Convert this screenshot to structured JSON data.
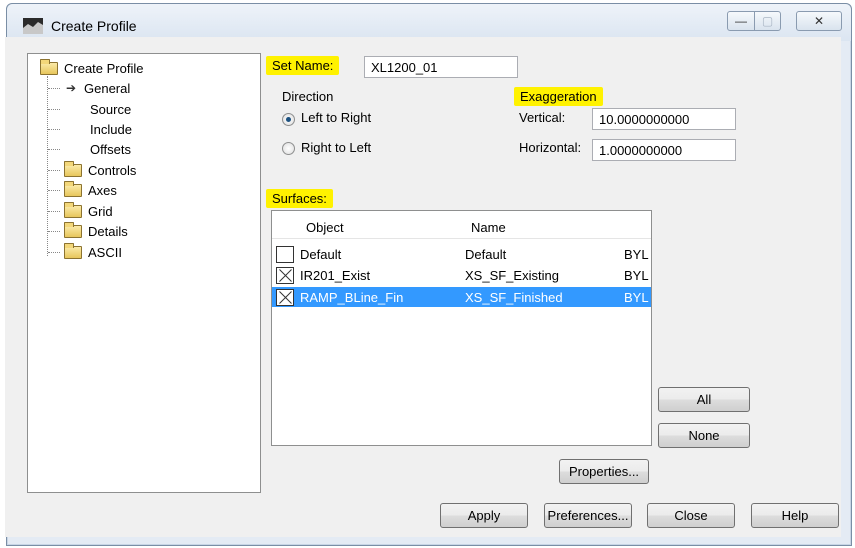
{
  "window": {
    "title": "Create Profile",
    "min_glyph": "—",
    "max_glyph": "▢",
    "close_glyph": "✕"
  },
  "tree": {
    "root": "Create Profile",
    "items": [
      {
        "label": "General",
        "selected": true
      },
      {
        "label": "Source"
      },
      {
        "label": "Include"
      },
      {
        "label": "Offsets"
      },
      {
        "label": "Controls"
      },
      {
        "label": "Axes"
      },
      {
        "label": "Grid"
      },
      {
        "label": "Details"
      },
      {
        "label": "ASCII"
      }
    ]
  },
  "set_name": {
    "label": "Set Name:",
    "value": "XL1200_01"
  },
  "direction": {
    "label": "Direction",
    "options": [
      "Left to Right",
      "Right to Left"
    ],
    "selected": "Left to Right"
  },
  "exaggeration": {
    "label": "Exaggeration",
    "vertical_label": "Vertical:",
    "vertical_value": "10.0000000000",
    "horizontal_label": "Horizontal:",
    "horizontal_value": "1.0000000000"
  },
  "surfaces": {
    "label": "Surfaces:",
    "columns": [
      "Object",
      "Name"
    ],
    "rows": [
      {
        "object": "Default",
        "name": "Default",
        "extra": "BYL",
        "checked": false,
        "selected": false
      },
      {
        "object": "IR201_Exist",
        "name": "XS_SF_Existing",
        "extra": "BYL",
        "checked": true,
        "selected": false
      },
      {
        "object": "RAMP_BLine_Fin",
        "name": "XS_SF_Finished",
        "extra": "BYL",
        "checked": true,
        "selected": true
      }
    ]
  },
  "buttons": {
    "all": "All",
    "none": "None",
    "properties": "Properties...",
    "apply": "Apply",
    "preferences": "Preferences...",
    "close": "Close",
    "help": "Help"
  },
  "colors": {
    "highlight": "#fff200",
    "selection": "#3399ff"
  }
}
